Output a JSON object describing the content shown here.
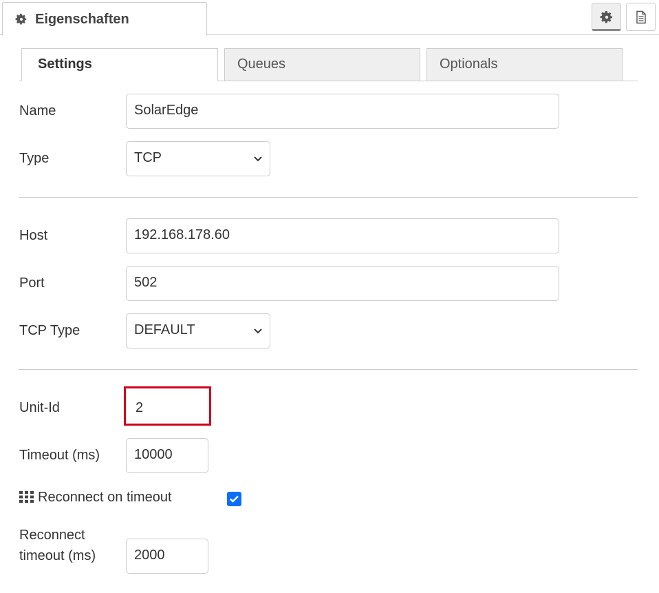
{
  "header": {
    "title": "Eigenschaften",
    "title_icon": "gear-icon",
    "buttons": [
      {
        "icon": "gear-icon",
        "active": true
      },
      {
        "icon": "document-icon",
        "active": false
      }
    ]
  },
  "tabs": [
    {
      "label": "Settings",
      "active": true
    },
    {
      "label": "Queues",
      "active": false
    },
    {
      "label": "Optionals",
      "active": false
    }
  ],
  "form": {
    "name": {
      "label": "Name",
      "value": "SolarEdge"
    },
    "type": {
      "label": "Type",
      "value": "TCP"
    },
    "host": {
      "label": "Host",
      "value": "192.168.178.60"
    },
    "port": {
      "label": "Port",
      "value": "502"
    },
    "tcp_type": {
      "label": "TCP Type",
      "value": "DEFAULT"
    },
    "unit_id": {
      "label": "Unit-Id",
      "value": "2",
      "highlight_color": "#d0021b"
    },
    "timeout": {
      "label": "Timeout (ms)",
      "value": "10000"
    },
    "reconnect": {
      "label": "Reconnect on timeout",
      "checked": true,
      "icon": "grid-icon",
      "checkbox_color": "#0d6efd"
    },
    "reconnect_timeout": {
      "label_line1": "Reconnect",
      "label_line2": "timeout (ms)",
      "value": "2000"
    }
  }
}
